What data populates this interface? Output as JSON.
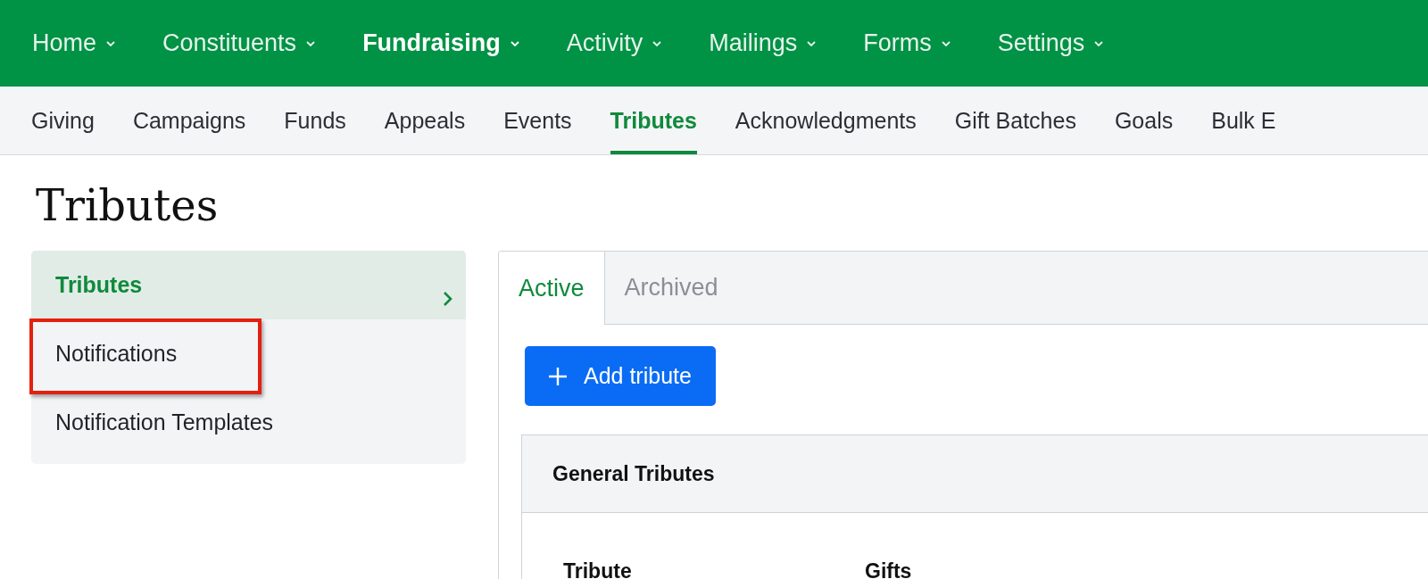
{
  "main_nav": [
    {
      "label": "Home",
      "selected": false
    },
    {
      "label": "Constituents",
      "selected": false
    },
    {
      "label": "Fundraising",
      "selected": true
    },
    {
      "label": "Activity",
      "selected": false
    },
    {
      "label": "Mailings",
      "selected": false
    },
    {
      "label": "Forms",
      "selected": false
    },
    {
      "label": "Settings",
      "selected": false
    }
  ],
  "sub_nav": [
    {
      "label": "Giving",
      "selected": false
    },
    {
      "label": "Campaigns",
      "selected": false
    },
    {
      "label": "Funds",
      "selected": false
    },
    {
      "label": "Appeals",
      "selected": false
    },
    {
      "label": "Events",
      "selected": false
    },
    {
      "label": "Tributes",
      "selected": true
    },
    {
      "label": "Acknowledgments",
      "selected": false
    },
    {
      "label": "Gift Batches",
      "selected": false
    },
    {
      "label": "Goals",
      "selected": false
    },
    {
      "label": "Bulk E",
      "selected": false
    }
  ],
  "page_title": "Tributes",
  "sidebar": {
    "items": [
      {
        "label": "Tributes",
        "selected": true,
        "highlighted": false
      },
      {
        "label": "Notifications",
        "selected": false,
        "highlighted": true
      },
      {
        "label": "Notification Templates",
        "selected": false,
        "highlighted": false
      }
    ]
  },
  "tabs": [
    {
      "label": "Active",
      "selected": true
    },
    {
      "label": "Archived",
      "selected": false
    }
  ],
  "add_button": {
    "label": "Add tribute"
  },
  "card": {
    "title": "General Tributes",
    "columns": [
      "Tribute",
      "Gifts"
    ]
  }
}
